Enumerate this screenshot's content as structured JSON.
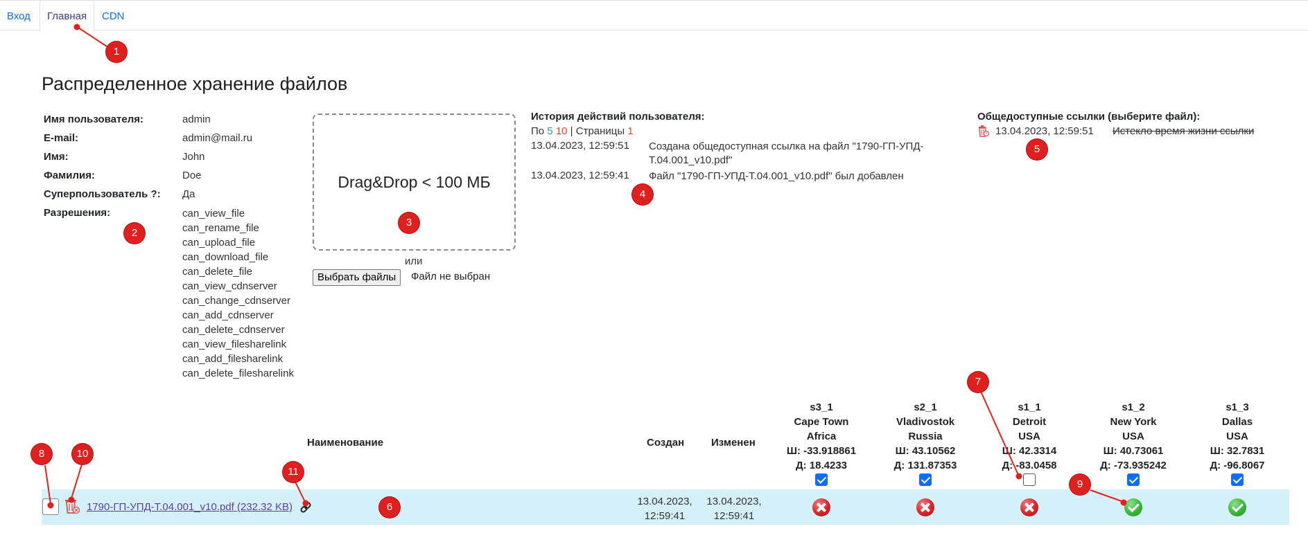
{
  "tabs": [
    {
      "label": "Вход"
    },
    {
      "label": "Главная"
    },
    {
      "label": "CDN"
    }
  ],
  "page_title": "Распределенное хранение файлов",
  "user": {
    "username_label": "Имя пользователя:",
    "username": "admin",
    "email_label": "E-mail:",
    "email": "admin@mail.ru",
    "first_name_label": "Имя:",
    "first_name": "John",
    "last_name_label": "Фамилия:",
    "last_name": "Doe",
    "superuser_label": "Суперпользователь ?:",
    "superuser": "Да",
    "permissions_label": "Разрешения:",
    "permissions": [
      "can_view_file",
      "can_rename_file",
      "can_upload_file",
      "can_download_file",
      "can_delete_file",
      "can_view_cdnserver",
      "can_change_cdnserver",
      "can_add_cdnserver",
      "can_delete_cdnserver",
      "can_view_filesharelink",
      "can_add_filesharelink",
      "can_delete_filesharelink"
    ]
  },
  "upload": {
    "dropzone_text": "Drag&Drop < 100 МБ",
    "or_text": "или",
    "choose_button": "Выбрать файлы",
    "no_file_text": "Файл не выбран"
  },
  "history": {
    "title": "История действий пользователя:",
    "per_page_prefix": "По",
    "per_page_5": "5",
    "per_page_10": "10",
    "pages_label": "| Страницы",
    "page_1": "1",
    "entries": [
      {
        "date": "13.04.2023, 12:59:51",
        "text": "Создана общедоступная ссылка на файл \"1790-ГП-УПД-Т.04.001_v10.pdf\""
      },
      {
        "date": "13.04.2023, 12:59:41",
        "text": "Файл \"1790-ГП-УПД-Т.04.001_v10.pdf\" был добавлен"
      }
    ]
  },
  "public_links": {
    "title": "Общедоступные ссылки (выберите файл):",
    "items": [
      {
        "date": "13.04.2023, 12:59:51",
        "status": "Истекло время жизни ссылки"
      }
    ]
  },
  "table": {
    "col_name": "Наименование",
    "col_created": "Создан",
    "col_modified": "Изменен",
    "servers": [
      {
        "id": "s3_1",
        "city": "Cape Town",
        "region": "Africa",
        "lat": "Ш: -33.918861",
        "lon": "Д: 18.4233",
        "checked": true
      },
      {
        "id": "s2_1",
        "city": "Vladivostok",
        "region": "Russia",
        "lat": "Ш: 43.10562",
        "lon": "Д: 131.87353",
        "checked": true
      },
      {
        "id": "s1_1",
        "city": "Detroit",
        "region": "USA",
        "lat": "Ш: 42.3314",
        "lon": "Д: -83.0458",
        "checked": false
      },
      {
        "id": "s1_2",
        "city": "New York",
        "region": "USA",
        "lat": "Ш: 40.73061",
        "lon": "Д: -73.935242",
        "checked": true
      },
      {
        "id": "s1_3",
        "city": "Dallas",
        "region": "USA",
        "lat": "Ш: 32.7831",
        "lon": "Д: -96.8067",
        "checked": true
      }
    ],
    "rows": [
      {
        "file": "1790-ГП-УПД-Т.04.001_v10.pdf (232.32 KB)",
        "created_date": "13.04.2023,",
        "created_time": "12:59:41",
        "modified_date": "13.04.2023,",
        "modified_time": "12:59:41",
        "status": [
          "error",
          "error",
          "error",
          "ok",
          "ok"
        ]
      }
    ]
  },
  "annotations": [
    "1",
    "2",
    "3",
    "4",
    "5",
    "6",
    "7",
    "8",
    "9",
    "10",
    "11"
  ],
  "colors": {
    "link": "#0d6efd",
    "row_bg": "#d4f1fa",
    "badge": "#e0201f",
    "ok": "#38b438",
    "error": "#d4252a"
  }
}
